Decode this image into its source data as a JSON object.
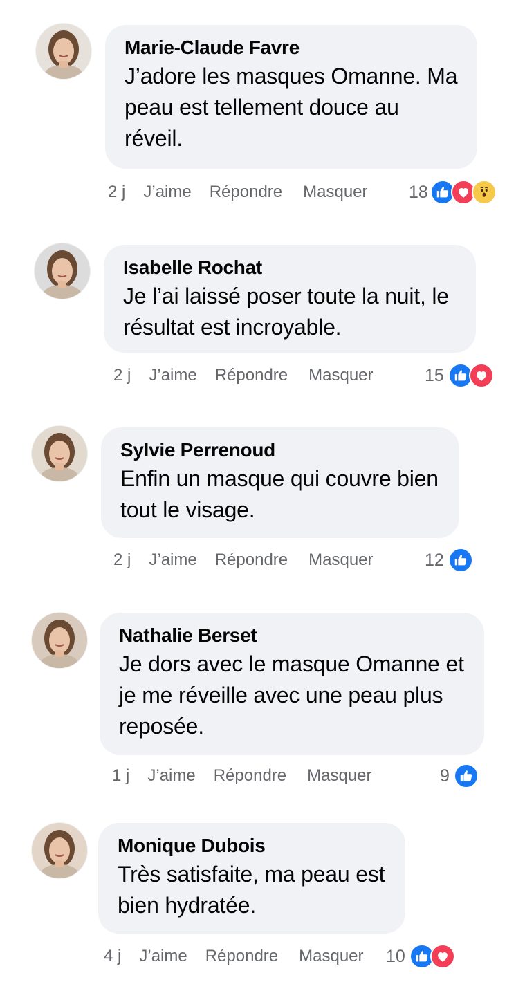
{
  "comments": [
    {
      "author": "Marie-Claude Favre",
      "text": "J’adore les masques Omanne. Ma peau est tellement douce au réveil.",
      "time": "2 j",
      "like_label": "J’aime",
      "reply_label": "Répondre",
      "hide_label": "Masquer",
      "reaction_count": "18",
      "reactions": [
        "like-icon",
        "love-icon",
        "wow-icon"
      ]
    },
    {
      "author": "Isabelle Rochat",
      "text": "Je l’ai laissé poser toute la nuit, le résultat est incroyable.",
      "time": "2 j",
      "like_label": "J’aime",
      "reply_label": "Répondre",
      "hide_label": "Masquer",
      "reaction_count": "15",
      "reactions": [
        "like-icon",
        "love-icon"
      ]
    },
    {
      "author": "Sylvie Perrenoud",
      "text": "Enfin un masque qui couvre bien tout le visage.",
      "time": "2 j",
      "like_label": "J’aime",
      "reply_label": "Répondre",
      "hide_label": "Masquer",
      "reaction_count": "12",
      "reactions": [
        "like-icon"
      ]
    },
    {
      "author": "Nathalie Berset",
      "text": "Je dors avec le masque Omanne et je me réveille avec une peau plus reposée.",
      "time": "1 j",
      "like_label": "J’aime",
      "reply_label": "Répondre",
      "hide_label": "Masquer",
      "reaction_count": "9",
      "reactions": [
        "like-icon"
      ]
    },
    {
      "author": "Monique Dubois",
      "text": "Très satisfaite, ma peau est bien hydratée.",
      "time": "4 j",
      "like_label": "J’aime",
      "reply_label": "Répondre",
      "hide_label": "Masquer",
      "reaction_count": "10",
      "reactions": [
        "like-icon",
        "love-icon"
      ]
    }
  ],
  "colors": {
    "bubble": "#f0f2f5",
    "meta_text": "#65676b",
    "like": "#1877f2",
    "love": "#f33e58",
    "wow": "#f7c94b"
  }
}
